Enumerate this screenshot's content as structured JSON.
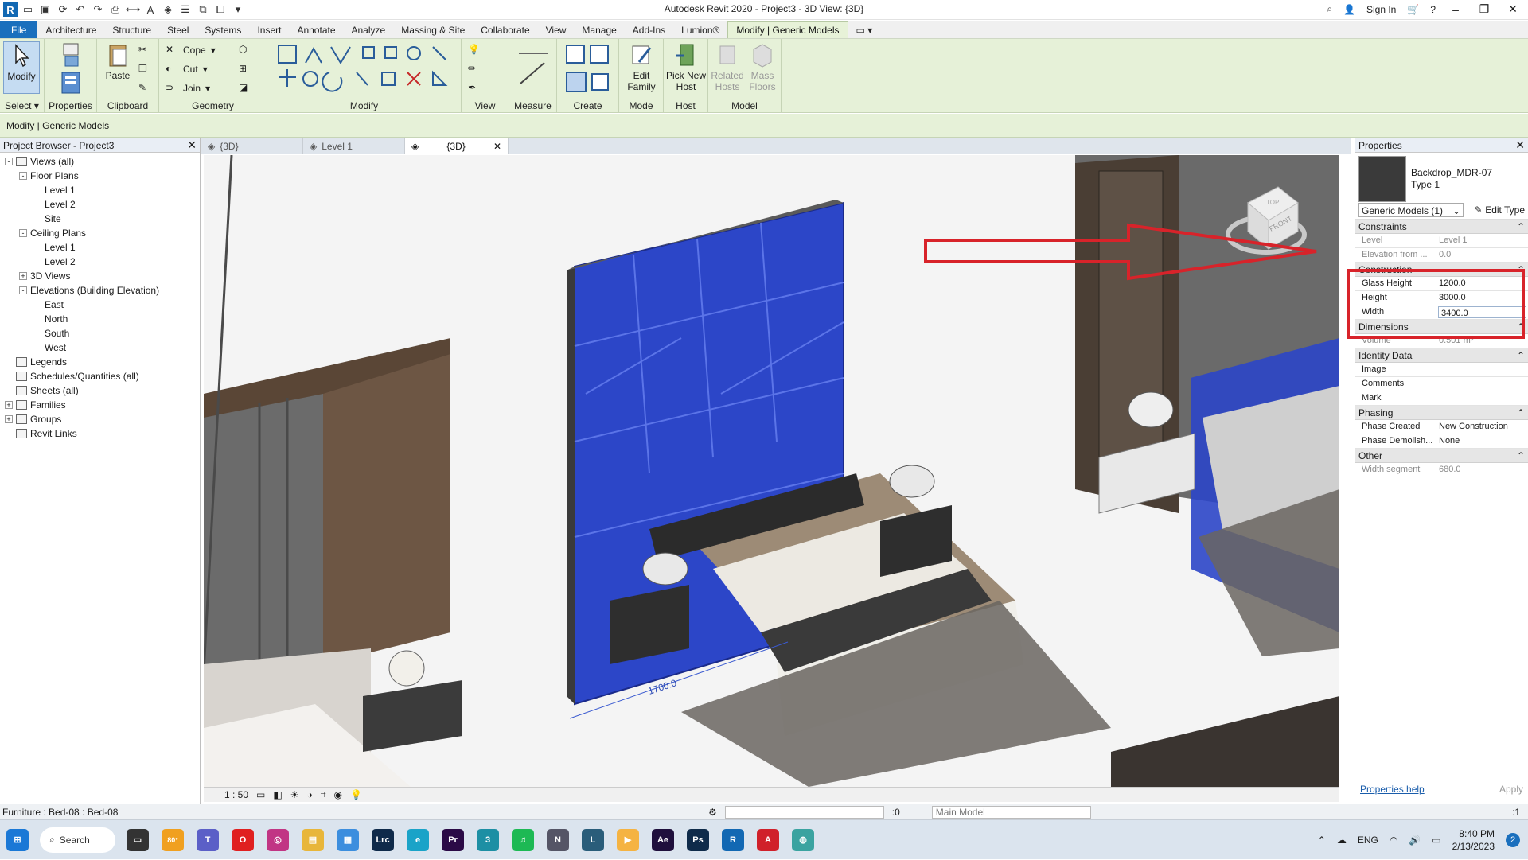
{
  "window": {
    "title": "Autodesk Revit 2020 - Project3 - 3D View: {3D}",
    "sign_in": "Sign In"
  },
  "ribbon_tabs": [
    "File",
    "Architecture",
    "Structure",
    "Steel",
    "Systems",
    "Insert",
    "Annotate",
    "Analyze",
    "Massing & Site",
    "Collaborate",
    "View",
    "Manage",
    "Add-Ins",
    "Lumion®",
    "Modify | Generic Models"
  ],
  "ribbon": {
    "select": {
      "label": "Select",
      "modify": "Modify"
    },
    "properties": {
      "label": "Properties"
    },
    "clipboard": {
      "label": "Clipboard",
      "paste": "Paste"
    },
    "geometry": {
      "label": "Geometry",
      "cope": "Cope",
      "cut": "Cut",
      "join": "Join"
    },
    "modify": {
      "label": "Modify"
    },
    "view": {
      "label": "View"
    },
    "measure": {
      "label": "Measure"
    },
    "create": {
      "label": "Create"
    },
    "mode": {
      "label": "Mode",
      "edit_family": "Edit Family"
    },
    "host": {
      "label": "Host",
      "pick_new_host": "Pick New Host"
    },
    "model": {
      "label": "Model",
      "related_hosts": "Related Hosts",
      "mass_floors": "Mass Floors"
    }
  },
  "options_bar": {
    "text": "Modify | Generic Models"
  },
  "project_browser": {
    "title": "Project Browser - Project3",
    "nodes": [
      {
        "label": "Views (all)",
        "level": 0,
        "toggle": "-"
      },
      {
        "label": "Floor Plans",
        "level": 1,
        "toggle": "-"
      },
      {
        "label": "Level 1",
        "level": 2,
        "toggle": ""
      },
      {
        "label": "Level 2",
        "level": 2,
        "toggle": ""
      },
      {
        "label": "Site",
        "level": 2,
        "toggle": ""
      },
      {
        "label": "Ceiling Plans",
        "level": 1,
        "toggle": "-"
      },
      {
        "label": "Level 1",
        "level": 2,
        "toggle": ""
      },
      {
        "label": "Level 2",
        "level": 2,
        "toggle": ""
      },
      {
        "label": "3D Views",
        "level": 1,
        "toggle": "+"
      },
      {
        "label": "Elevations (Building Elevation)",
        "level": 1,
        "toggle": "-"
      },
      {
        "label": "East",
        "level": 2,
        "toggle": ""
      },
      {
        "label": "North",
        "level": 2,
        "toggle": ""
      },
      {
        "label": "South",
        "level": 2,
        "toggle": ""
      },
      {
        "label": "West",
        "level": 2,
        "toggle": ""
      },
      {
        "label": "Legends",
        "level": 0,
        "toggle": ""
      },
      {
        "label": "Schedules/Quantities (all)",
        "level": 0,
        "toggle": ""
      },
      {
        "label": "Sheets (all)",
        "level": 0,
        "toggle": ""
      },
      {
        "label": "Families",
        "level": 0,
        "toggle": "+"
      },
      {
        "label": "Groups",
        "level": 0,
        "toggle": "+"
      },
      {
        "label": "Revit Links",
        "level": 0,
        "toggle": ""
      }
    ]
  },
  "view_tabs": [
    {
      "label": "{3D}",
      "active": false
    },
    {
      "label": "Level 1",
      "active": false
    },
    {
      "label": "{3D}",
      "active": true
    }
  ],
  "viewport": {
    "dimension_label": "1700.0",
    "scale": "1 : 50",
    "viewcube": "FRONT",
    "viewcube_top": "TOP"
  },
  "properties": {
    "title": "Properties",
    "type_family": "Backdrop_MDR-07",
    "type_name": "Type 1",
    "instance_filter": "Generic Models (1)",
    "edit_type": "Edit Type",
    "categories": [
      {
        "name": "Constraints",
        "rows": [
          {
            "k": "Level",
            "v": "Level 1",
            "grey": true
          },
          {
            "k": "Elevation from ...",
            "v": "0.0",
            "grey": true
          }
        ]
      },
      {
        "name": "Construction",
        "rows": [
          {
            "k": "Glass Height",
            "v": "1200.0",
            "grey": false
          },
          {
            "k": "Height",
            "v": "3000.0",
            "grey": false
          },
          {
            "k": "Width",
            "v": "3400.0",
            "grey": false,
            "edit": true
          }
        ]
      },
      {
        "name": "Dimensions",
        "rows": [
          {
            "k": "Volume",
            "v": "0.501 m³",
            "grey": true
          }
        ]
      },
      {
        "name": "Identity Data",
        "rows": [
          {
            "k": "Image",
            "v": "",
            "grey": false
          },
          {
            "k": "Comments",
            "v": "",
            "grey": false
          },
          {
            "k": "Mark",
            "v": "",
            "grey": false
          }
        ]
      },
      {
        "name": "Phasing",
        "rows": [
          {
            "k": "Phase Created",
            "v": "New Construction",
            "grey": false
          },
          {
            "k": "Phase Demolish...",
            "v": "None",
            "grey": false
          }
        ]
      },
      {
        "name": "Other",
        "rows": [
          {
            "k": "Width segment",
            "v": "680.0",
            "grey": true
          }
        ]
      }
    ],
    "help": "Properties help",
    "apply": "Apply"
  },
  "status": {
    "left": "Furniture : Bed-08 : Bed-08",
    "workset": ":0",
    "model": "Main Model",
    "filter": ":1"
  },
  "taskbar": {
    "search": "Search",
    "weather": "80°",
    "lang": "ENG",
    "time": "8:40 PM",
    "date": "2/13/2023",
    "badge": "2"
  },
  "colors": {
    "ribbon_bg": "#e6f1d8",
    "file_tab": "#1a6fbd",
    "selection_blue": "#2c46c8",
    "annotation_red": "#d8232a"
  }
}
